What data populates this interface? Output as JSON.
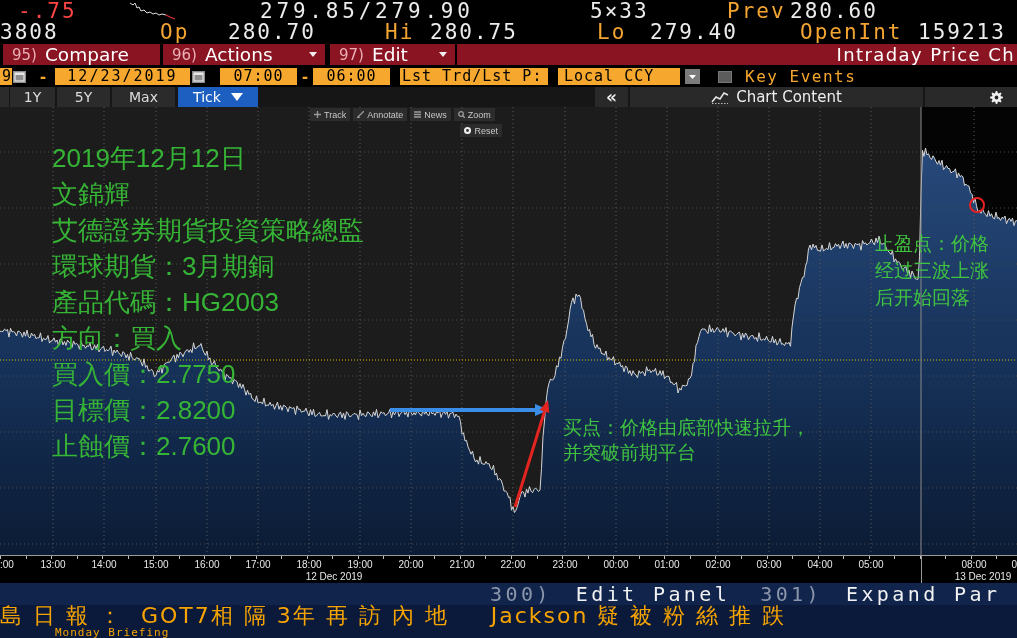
{
  "header": {
    "change": {
      "text": "-.75",
      "negative": true
    },
    "bid_ask": "279.85/279.90",
    "size": "5×33",
    "row_1_stats": [
      {
        "label": "Prev",
        "value": "280.60"
      }
    ],
    "row_2_lead": "3808",
    "row_2_stats": [
      {
        "label": "Op",
        "value": "280.70"
      },
      {
        "label": "Hi",
        "value": "280.75"
      },
      {
        "label": "Lo",
        "value": "279.40"
      },
      {
        "label": "OpenInt",
        "value": "159213"
      }
    ]
  },
  "menu_bar": {
    "buttons": [
      {
        "number": "95)",
        "label": "Compare",
        "dropdown": false
      },
      {
        "number": "96)",
        "label": "Actions",
        "dropdown": true
      },
      {
        "number": "97)",
        "label": "Edit",
        "dropdown": true
      }
    ],
    "title": "Intraday Price Ch"
  },
  "range_bar": {
    "start_date": "9",
    "date_separator": "-",
    "end_date": "12/23/2019",
    "start_time": "07:00",
    "time_separator": "-",
    "end_time": "06:00",
    "price_field": "Lst Trd/Lst P:",
    "currency": "Local CCY",
    "key_events": {
      "label": "Key Events",
      "checked": false
    }
  },
  "period_tabs": [
    {
      "label": "1Y",
      "selected": false,
      "dropdown": false
    },
    {
      "label": "5Y",
      "selected": false,
      "dropdown": false
    },
    {
      "label": "Max",
      "selected": false,
      "dropdown": false
    },
    {
      "label": "Tick",
      "selected": true,
      "dropdown": true
    }
  ],
  "chart_toolbar": {
    "collapse_button": "«",
    "content_button": "Chart Content"
  },
  "chart": {
    "tools": [
      {
        "kind": "track",
        "label": "Track"
      },
      {
        "kind": "annotate",
        "label": "Annotate"
      },
      {
        "kind": "news",
        "label": "News"
      },
      {
        "kind": "zoom",
        "label": "Zoom"
      }
    ],
    "reset_button": "Reset",
    "x_axis_labels": [
      ":00",
      "13:00",
      "14:00",
      "15:00",
      "16:00",
      "17:00",
      "18:00",
      "19:00",
      "20:00",
      "21:00",
      "22:00",
      "23:00",
      "00:00",
      "01:00",
      "02:00",
      "03:00",
      "04:00",
      "05:00",
      "08:00",
      "0"
    ],
    "date_labels": [
      "12 Dec 2019",
      "13 Dec 2019"
    ]
  },
  "overlay": {
    "info_lines": [
      "2019年12月12日",
      "文錦輝",
      "艾德證券期貨投資策略總監",
      "環球期貨：3月期銅",
      "產品代碼：HG2003",
      "方向：買入",
      "買入價：2.7750",
      "目標價：2.8200",
      "止蝕價：2.7600"
    ],
    "annotations": [
      {
        "kind": "buy",
        "text_lines": [
          "买点：价格由底部快速拉升，",
          "并突破前期平台"
        ]
      },
      {
        "kind": "take_profit",
        "text_lines": [
          "止盈点：价格",
          "经过三波上涨",
          "后开始回落"
        ]
      }
    ]
  },
  "ticker": {
    "commands": [
      {
        "number": "300)",
        "label": "Edit Panel"
      },
      {
        "number": "301)",
        "label": "Expand Par"
      }
    ],
    "headlines": [
      "島日報： GOT7相隔3年再訪內地",
      "Jackson 疑被粉絲推跌"
    ],
    "headline_line_2": "Monday Briefing"
  }
}
